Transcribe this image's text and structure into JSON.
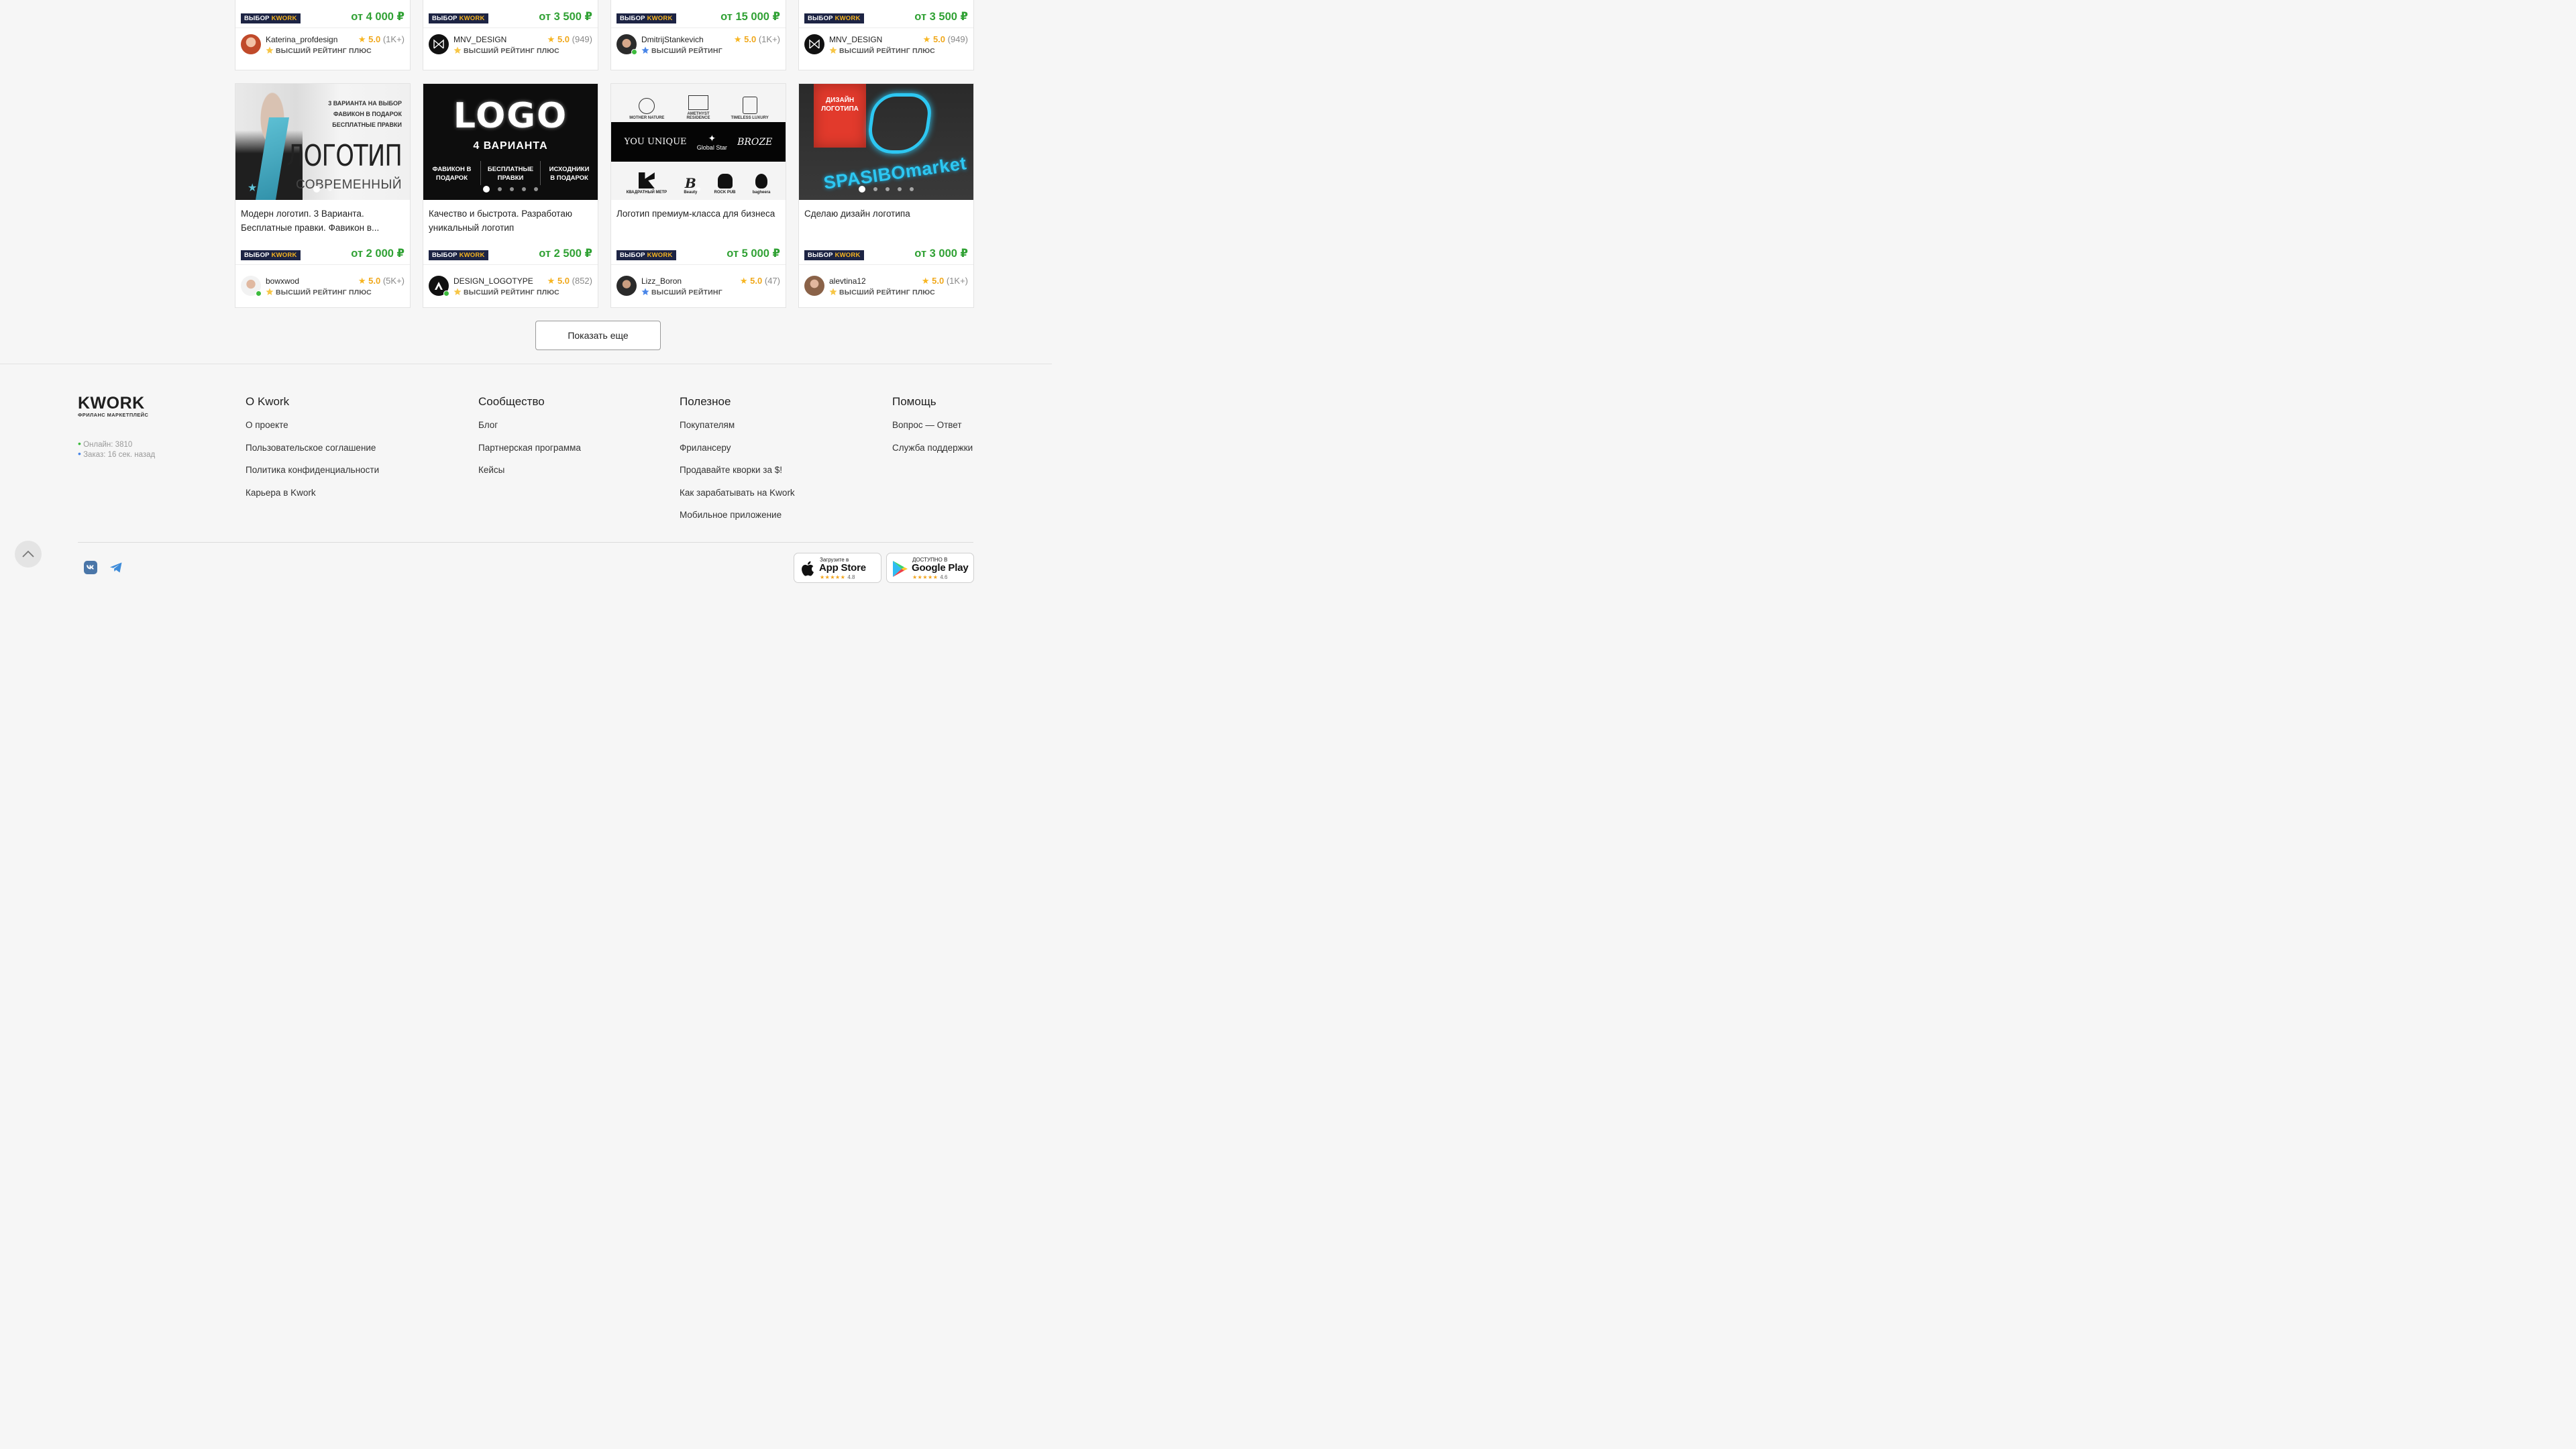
{
  "choice_label": {
    "prefix": "ВЫБОР",
    "brand": "KWORK"
  },
  "top_cards": [
    {
      "price": "от 4 000 ₽",
      "seller": "Katerina_profdesign",
      "rating": "5.0",
      "count": "(1K+)",
      "level": "ВЫСШИЙ РЕЙТИНГ ПЛЮС",
      "online": false
    },
    {
      "price": "от 3 500 ₽",
      "seller": "MNV_DESIGN",
      "rating": "5.0",
      "count": "(949)",
      "level": "ВЫСШИЙ РЕЙТИНГ ПЛЮС",
      "online": false
    },
    {
      "price": "от 15 000 ₽",
      "seller": "DmitrijStankevich",
      "rating": "5.0",
      "count": "(1K+)",
      "level": "ВЫСШИЙ РЕЙТИНГ",
      "online": true
    },
    {
      "price": "от 3 500 ₽",
      "seller": "MNV_DESIGN",
      "rating": "5.0",
      "count": "(949)",
      "level": "ВЫСШИЙ РЕЙТИНГ ПЛЮС",
      "online": false
    }
  ],
  "cards": [
    {
      "title": "Модерн логотип. 3 Варианта. Бесплатные правки. Фавикон в...",
      "price": "от 2 000 ₽",
      "seller": "bowxwod",
      "rating": "5.0",
      "count": "(5K+)",
      "level": "ВЫСШИЙ РЕЙТИНГ ПЛЮС",
      "online": true,
      "image_text": {
        "l1": "3 ВАРИАНТА НА ВЫБОР",
        "l2": "ФАВИКОН В ПОДАРОК",
        "l3": "БЕСПЛАТНЫЕ ПРАВКИ",
        "big": "ЛОГОТИП",
        "small": "СОВРЕМЕННЫЙ"
      }
    },
    {
      "title": "Качество и быстрота. Разработаю уникальный логотип",
      "price": "от 2 500 ₽",
      "seller": "DESIGN_LOGOTYPE",
      "rating": "5.0",
      "count": "(852)",
      "level": "ВЫСШИЙ РЕЙТИНГ ПЛЮС",
      "online": true,
      "image_text": {
        "big": "LOGO",
        "sub": "4 ВАРИАНТА",
        "c1": "ФАВИКОН В ПОДАРОК",
        "c2": "БЕСПЛАТНЫЕ ПРАВКИ",
        "c3": "ИСХОДНИКИ В ПОДАРОК"
      }
    },
    {
      "title": "Логотип премиум-класса для бизнеса",
      "price": "от 5 000 ₽",
      "seller": "Lizz_Boron",
      "rating": "5.0",
      "count": "(47)",
      "level": "ВЫСШИЙ РЕЙТИНГ",
      "online": false,
      "image_text": {
        "a": "MOTHER NATURE",
        "b": "AMETHYST RESIDENCE",
        "c": "TIMELESS LUXURY",
        "d": "YOU UNIQUE",
        "e": "Global Star",
        "f": "BROZE",
        "g": "КВАДРАТНЫЙ МЕТР",
        "h": "Beauty",
        "i": "ROCK PUB",
        "j": "bagheera"
      }
    },
    {
      "title": "Сделаю дизайн логотипа",
      "price": "от 3 000 ₽",
      "seller": "alevtina12",
      "rating": "5.0",
      "count": "(1K+)",
      "level": "ВЫСШИЙ РЕЙТИНГ ПЛЮС",
      "online": false,
      "image_text": {
        "tag": "ДИЗАЙН ЛОГОТИПА",
        "big": "SPASIBOmarket"
      }
    }
  ],
  "show_more": "Показать еще",
  "footer": {
    "logo": "KWORK",
    "logo_sub": "ФРИЛАНС МАРКЕТПЛЕЙС",
    "online": "Онлайн: 3810",
    "order": "Заказ: 16 сек. назад",
    "columns": [
      {
        "title": "О Kwork",
        "links": [
          "О проекте",
          "Пользовательское соглашение",
          "Политика конфиденциальности",
          "Карьера в Kwork"
        ]
      },
      {
        "title": "Сообщество",
        "links": [
          "Блог",
          "Партнерская программа",
          "Кейсы"
        ]
      },
      {
        "title": "Полезное",
        "links": [
          "Покупателям",
          "Фрилансеру",
          "Продавайте кворки за $!",
          "Как зарабатывать на Kwork",
          "Мобильное приложение"
        ]
      },
      {
        "title": "Помощь",
        "links": [
          "Вопрос — Ответ",
          "Служба поддержки"
        ]
      }
    ],
    "app_store": {
      "small": "Загрузите в",
      "big": "App Store",
      "stars": "★★★★★",
      "rating": "4.8"
    },
    "google_play": {
      "small": "ДОСТУПНО В",
      "big": "Google Play",
      "stars": "★★★★★",
      "rating": "4.6"
    }
  },
  "colors": {
    "price": "#30a134",
    "star": "#f7b520",
    "choice_bg": "#1d2444"
  }
}
